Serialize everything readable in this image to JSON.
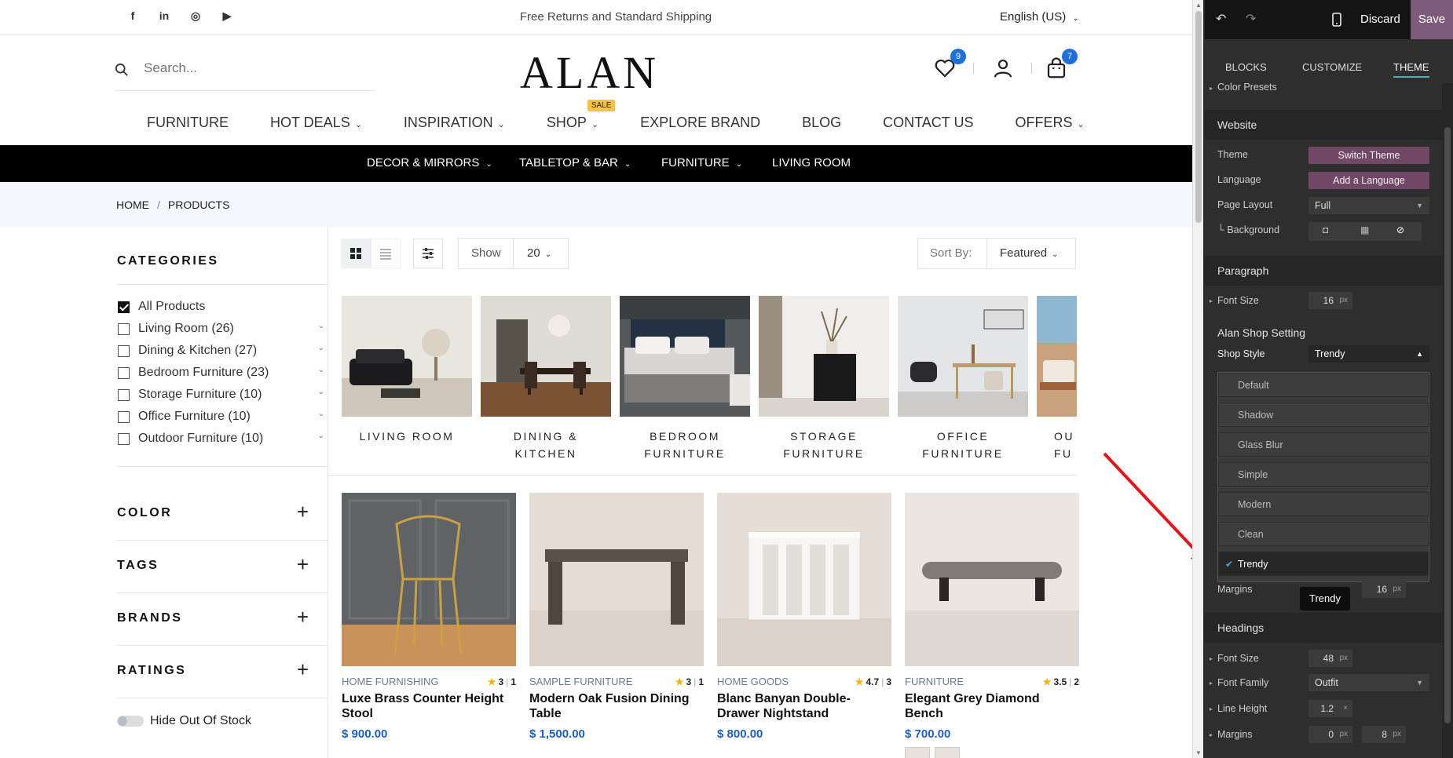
{
  "topbar": {
    "social": [
      "f",
      "in",
      "◎",
      "▶"
    ],
    "promo": "Free Returns and Standard Shipping",
    "language": "English (US)"
  },
  "header": {
    "search_placeholder": "Search...",
    "logo": "ALAN",
    "wishlist_count": "9",
    "cart_count": "7"
  },
  "main_nav": {
    "items": [
      "FURNITURE",
      "HOT DEALS",
      "INSPIRATION",
      "SHOP",
      "EXPLORE BRAND",
      "BLOG",
      "CONTACT US",
      "OFFERS"
    ],
    "sale_badge": "SALE"
  },
  "sub_nav": [
    "DECOR & MIRRORS",
    "TABLETOP & BAR",
    "FURNITURE",
    "LIVING ROOM"
  ],
  "breadcrumb": {
    "home": "HOME",
    "sep": "/",
    "current": "PRODUCTS"
  },
  "sidebar": {
    "categories_title": "CATEGORIES",
    "categories": [
      {
        "label": "All Products",
        "checked": true
      },
      {
        "label": "Living Room (26)"
      },
      {
        "label": "Dining & Kitchen (27)"
      },
      {
        "label": "Bedroom Furniture (23)"
      },
      {
        "label": "Storage Furniture (10)"
      },
      {
        "label": "Office Furniture (10)"
      },
      {
        "label": "Outdoor Furniture (10)"
      }
    ],
    "filters": [
      "COLOR",
      "TAGS",
      "BRANDS",
      "RATINGS"
    ],
    "hide_out_of_stock": "Hide Out Of Stock"
  },
  "toolbar": {
    "show_label": "Show",
    "show_value": "20",
    "sort_label": "Sort By:",
    "sort_value": "Featured"
  },
  "category_tiles": [
    {
      "line1": "LIVING ROOM",
      "line2": ""
    },
    {
      "line1": "DINING & KITCHEN",
      "line2": ""
    },
    {
      "line1": "BEDROOM",
      "line2": "FURNITURE"
    },
    {
      "line1": "STORAGE",
      "line2": "FURNITURE"
    },
    {
      "line1": "OFFICE FURNITURE",
      "line2": ""
    },
    {
      "line1": "OU",
      "line2": "FU"
    }
  ],
  "products": [
    {
      "category": "HOME FURNISHING",
      "rating": "3",
      "reviews": "1",
      "name": "Luxe Brass Counter Height Stool",
      "price": "$ 900.00"
    },
    {
      "category": "SAMPLE FURNITURE",
      "rating": "3",
      "reviews": "1",
      "name": "Modern Oak Fusion Dining Table",
      "price": "$ 1,500.00"
    },
    {
      "category": "HOME GOODS",
      "rating": "4.7",
      "reviews": "3",
      "name": "Blanc Banyan Double-Drawer Nightstand",
      "price": "$ 800.00"
    },
    {
      "category": "FURNITURE",
      "rating": "3.5",
      "reviews": "2",
      "name": "Elegant Grey Diamond Bench",
      "price": "$ 700.00"
    }
  ],
  "editor": {
    "discard": "Discard",
    "save": "Save",
    "tabs": [
      "BLOCKS",
      "CUSTOMIZE",
      "THEME"
    ],
    "color_presets": "Color Presets",
    "website_title": "Website",
    "theme_label": "Theme",
    "theme_btn": "Switch Theme",
    "language_label": "Language",
    "language_btn": "Add a Language",
    "page_layout_label": "Page Layout",
    "page_layout_value": "Full",
    "background_label": "└ Background",
    "paragraph_title": "Paragraph",
    "font_size_label": "Font Size",
    "paragraph_font_size": "16",
    "unit_px": "px",
    "shop_setting_title": "Alan Shop Setting",
    "shop_style_label": "Shop Style",
    "shop_style_value": "Trendy",
    "shop_style_options": [
      "Default",
      "Shadow",
      "Glass Blur",
      "Simple",
      "Modern",
      "Clean",
      "Trendy"
    ],
    "margins_label": "Margins",
    "margins_right": "16",
    "tooltip": "Trendy",
    "headings_title": "Headings",
    "headings_font_size": "48",
    "font_family_label": "Font Family",
    "font_family_value": "Outfit",
    "line_height_label": "Line Height",
    "line_height_value": "1.2",
    "line_height_unit": "×",
    "headings_margin_1": "0",
    "headings_margin_2": "8"
  },
  "colors": {
    "accent_blue": "#1a5fc7",
    "save_purple": "#7d5c7b",
    "editor_button": "#734866",
    "annotation_arrow": "#e8131a"
  }
}
